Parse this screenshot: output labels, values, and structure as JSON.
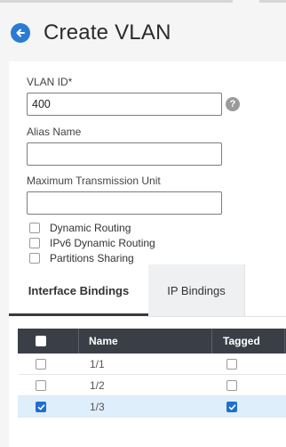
{
  "header": {
    "title": "Create VLAN"
  },
  "form": {
    "vlan_id": {
      "label": "VLAN ID*",
      "value": "400"
    },
    "alias_name": {
      "label": "Alias Name",
      "value": ""
    },
    "mtu": {
      "label": "Maximum Transmission Unit",
      "value": ""
    },
    "help_glyph": "?",
    "checkboxes": [
      {
        "label": "Dynamic Routing",
        "checked": false
      },
      {
        "label": "IPv6 Dynamic Routing",
        "checked": false
      },
      {
        "label": "Partitions Sharing",
        "checked": false
      }
    ]
  },
  "tabs": [
    {
      "label": "Interface Bindings",
      "active": true
    },
    {
      "label": "IP Bindings",
      "active": false
    }
  ],
  "table": {
    "columns": [
      "Name",
      "Tagged"
    ],
    "rows": [
      {
        "name": "1/1",
        "selected": false,
        "tagged": false
      },
      {
        "name": "1/2",
        "selected": false,
        "tagged": false
      },
      {
        "name": "1/3",
        "selected": true,
        "tagged": true
      }
    ]
  },
  "colors": {
    "accent": "#2a7bd4",
    "checkbox_checked": "#1f6fd1",
    "table_header": "#3a3f47",
    "selected_row": "#dfeefb"
  },
  "icons": {
    "back": "arrow-left-circle-icon",
    "help": "question-circle-icon",
    "check": "checkmark-icon"
  }
}
